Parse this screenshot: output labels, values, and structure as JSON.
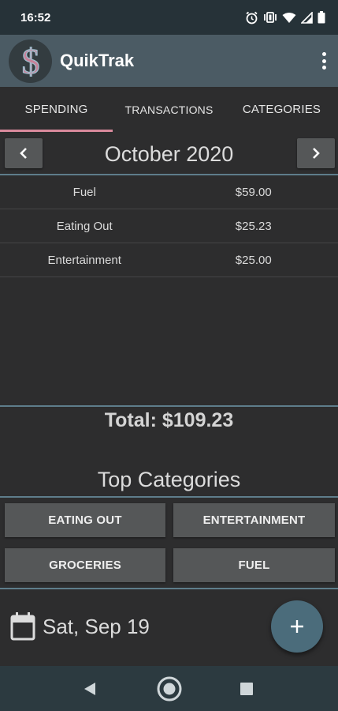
{
  "status_bar": {
    "time": "16:52",
    "icons": [
      "alarm-icon",
      "vibrate-icon",
      "wifi-icon",
      "signal-icon",
      "battery-icon"
    ]
  },
  "app_bar": {
    "title": "QuikTrak",
    "logo_icon": "dollar-icon",
    "menu_icon": "more-vert-icon"
  },
  "tabs": [
    {
      "label": "SPENDING",
      "active": true
    },
    {
      "label": "TRANSACTIONS",
      "active": false
    },
    {
      "label": "CATEGORIES",
      "active": false
    }
  ],
  "month": {
    "title": "October 2020",
    "prev_icon": "chevron-left-icon",
    "next_icon": "chevron-right-icon"
  },
  "spending": [
    {
      "category": "Fuel",
      "amount": "$59.00"
    },
    {
      "category": "Eating Out",
      "amount": "$25.23"
    },
    {
      "category": "Entertainment",
      "amount": "$25.00"
    }
  ],
  "total": "Total: $109.23",
  "top_categories": {
    "title": "Top Categories",
    "buttons": [
      "EATING OUT",
      "ENTERTAINMENT",
      "GROCERIES",
      "FUEL"
    ]
  },
  "date": {
    "label": "Sat, Sep 19",
    "icon": "calendar-icon"
  },
  "fab": {
    "icon": "plus-icon"
  },
  "colors": {
    "accent_tab": "#d98a9c",
    "app_bar": "#4b5b64",
    "fab": "#4b6c7b",
    "divider": "#5e7d8b"
  }
}
